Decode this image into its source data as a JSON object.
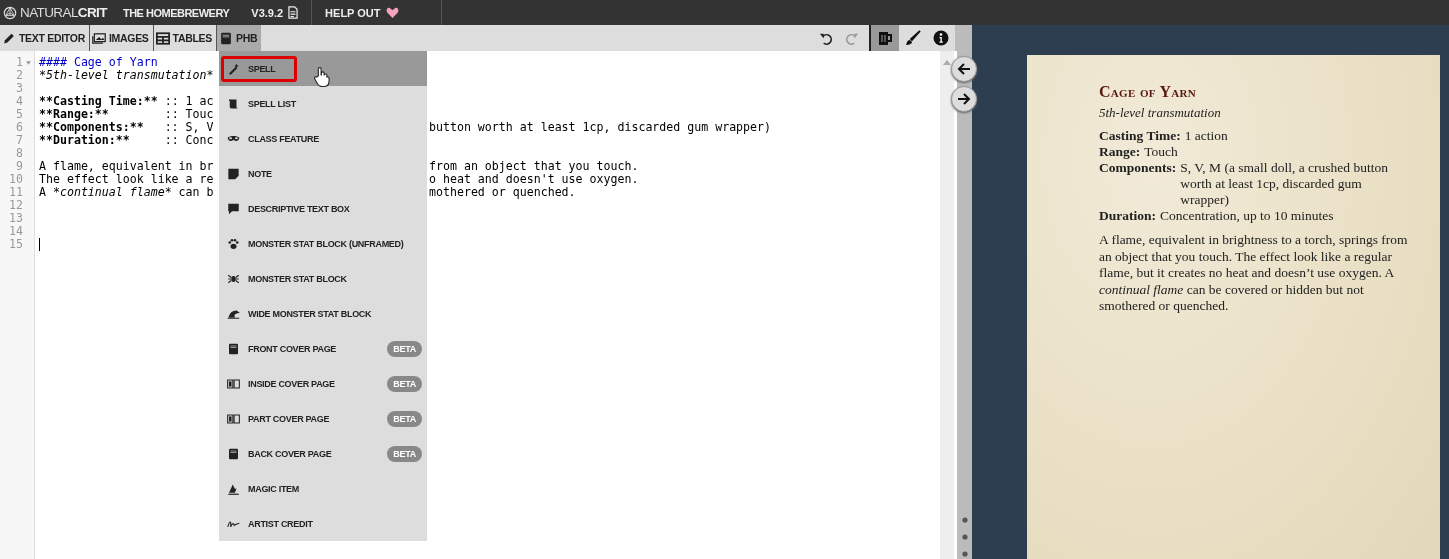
{
  "nav": {
    "logo_light": "NATURAL",
    "logo_bold": "CRIT",
    "title": "THE HOMEBREWERY",
    "version": "V3.9.2",
    "help": "HELP OUT"
  },
  "tabs": [
    {
      "label": "TEXT EDITOR",
      "selected": false
    },
    {
      "label": "IMAGES",
      "selected": false
    },
    {
      "label": "TABLES",
      "selected": false
    },
    {
      "label": "PHB",
      "selected": true
    }
  ],
  "toolbar": {
    "undo_disabled": false,
    "redo_disabled": true,
    "views": [
      {
        "selected": true
      },
      {
        "selected": false
      },
      {
        "selected": false
      }
    ]
  },
  "editor": {
    "lines": [
      {
        "number": "1",
        "foldable": true,
        "left": [
          {
            "kind": "heading",
            "text": "#### Cage of Yarn"
          }
        ]
      },
      {
        "number": "2",
        "left": [
          {
            "kind": "italic",
            "text": "*5th-level transmutation*"
          }
        ]
      },
      {
        "number": "3"
      },
      {
        "number": "4",
        "left": [
          {
            "kind": "bold",
            "text": "**Casting Time:**"
          },
          {
            "kind": "plain",
            "text": " :: 1 ac"
          }
        ]
      },
      {
        "number": "5",
        "left": [
          {
            "kind": "bold",
            "text": "**Range:**"
          },
          {
            "kind": "plain",
            "text": "        :: Touc"
          }
        ]
      },
      {
        "number": "6",
        "left": [
          {
            "kind": "bold",
            "text": "**Components:**"
          },
          {
            "kind": "plain",
            "text": "   :: S, V"
          }
        ],
        "right": [
          {
            "kind": "plain",
            "text": "button worth at least 1cp, discarded gum wrapper)"
          }
        ]
      },
      {
        "number": "7",
        "left": [
          {
            "kind": "bold",
            "text": "**Duration:**"
          },
          {
            "kind": "plain",
            "text": "     :: Conc"
          }
        ]
      },
      {
        "number": "8"
      },
      {
        "number": "9",
        "left": [
          {
            "kind": "plain",
            "text": "A flame, equivalent in br"
          }
        ],
        "right": [
          {
            "kind": "plain",
            "text": "from an object that you touch."
          }
        ]
      },
      {
        "number": "10",
        "left": [
          {
            "kind": "plain",
            "text": "The effect look like a re"
          }
        ],
        "right": [
          {
            "kind": "plain",
            "text": "o heat and doesn't use oxygen."
          }
        ]
      },
      {
        "number": "11",
        "left": [
          {
            "kind": "plain",
            "text": "A "
          },
          {
            "kind": "italic",
            "text": "*continual flame*"
          },
          {
            "kind": "plain",
            "text": " can b"
          }
        ],
        "right": [
          {
            "kind": "plain",
            "text": "mothered or quenched."
          }
        ]
      },
      {
        "number": "12"
      },
      {
        "number": "13"
      },
      {
        "number": "14"
      },
      {
        "number": "15",
        "cursor": true
      }
    ]
  },
  "snippets": [
    {
      "label": "SPELL",
      "selected": true,
      "beta": false
    },
    {
      "label": "SPELL LIST",
      "selected": false,
      "beta": false
    },
    {
      "label": "CLASS FEATURE",
      "selected": false,
      "beta": false
    },
    {
      "label": "NOTE",
      "selected": false,
      "beta": false
    },
    {
      "label": "DESCRIPTIVE TEXT BOX",
      "selected": false,
      "beta": false
    },
    {
      "label": "MONSTER STAT BLOCK (UNFRAMED)",
      "selected": false,
      "beta": false
    },
    {
      "label": "MONSTER STAT BLOCK",
      "selected": false,
      "beta": false
    },
    {
      "label": "WIDE MONSTER STAT BLOCK",
      "selected": false,
      "beta": false
    },
    {
      "label": "FRONT COVER PAGE",
      "selected": false,
      "beta": true,
      "badge": "BETA"
    },
    {
      "label": "INSIDE COVER PAGE",
      "selected": false,
      "beta": true,
      "badge": "BETA"
    },
    {
      "label": "PART COVER PAGE",
      "selected": false,
      "beta": true,
      "badge": "BETA"
    },
    {
      "label": "BACK COVER PAGE",
      "selected": false,
      "beta": true,
      "badge": "BETA"
    },
    {
      "label": "MAGIC ITEM",
      "selected": false,
      "beta": false
    },
    {
      "label": "ARTIST CREDIT",
      "selected": false,
      "beta": false
    }
  ],
  "preview": {
    "title": "Cage of Yarn",
    "subtitle": "5th-level transmutation",
    "properties": [
      {
        "label": "Casting Time:",
        "value": "1 action"
      },
      {
        "label": "Range:",
        "value": "Touch"
      },
      {
        "label": "Components:",
        "value": "S, V, M (a small doll, a crushed button worth at least 1cp, discarded gum wrapper)"
      },
      {
        "label": "Duration:",
        "value": "Concentration, up to 10 minutes"
      }
    ],
    "paragraph": "A flame, equivalent in brightness to a torch, springs from an object that you touch. The effect look like a regular flame, but it creates no heat and doesn’t use oxygen. A *continual flame* can be covered or hidden but not smothered or quenched."
  }
}
